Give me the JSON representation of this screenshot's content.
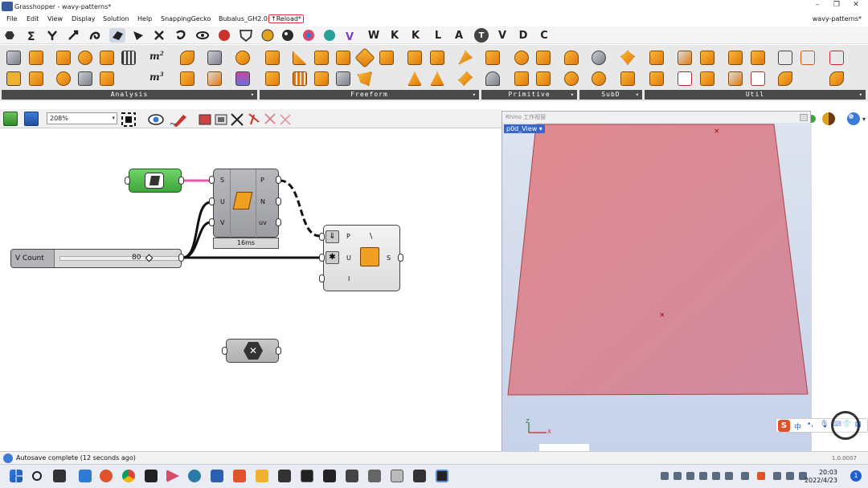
{
  "window": {
    "title": "Grasshopper - wavy-patterns*",
    "document": "wavy-patterns*"
  },
  "menu": {
    "items": [
      "File",
      "Edit",
      "View",
      "Display",
      "Solution",
      "Help",
      "SnappingGecko",
      "Bubalus_GH2.0",
      "Reload"
    ]
  },
  "tabs": {
    "letters": [
      "W",
      "K",
      "K",
      "L",
      "A",
      "V",
      "D",
      "C"
    ]
  },
  "ribbon": {
    "groups": [
      "Analysis",
      "Freeform",
      "Primitive",
      "SubD",
      "Util"
    ]
  },
  "canvas_toolbar": {
    "zoom": "208%"
  },
  "canvas": {
    "surface_component": {
      "inputs": [
        "S",
        "U",
        "V"
      ],
      "outputs": [
        "P",
        "N",
        "uv"
      ],
      "timer": "16ms"
    },
    "grid_component": {
      "inputs": [
        "P",
        "U",
        "I"
      ],
      "outputs": [
        "S"
      ]
    },
    "slider": {
      "label": "V Count",
      "value": "80"
    }
  },
  "rhino": {
    "title": "Rhino 工作视窗",
    "viewport_label": "p0d_View",
    "surface_color": "#e08a8e",
    "axis_z": "Z",
    "axis_x": "X"
  },
  "status": {
    "message": "Autosave complete (12 seconds ago)",
    "version": "1.0.0007"
  },
  "taskbar": {
    "time": "20:03",
    "date": "2022/4/23",
    "notifications": "1",
    "ime": "中"
  }
}
